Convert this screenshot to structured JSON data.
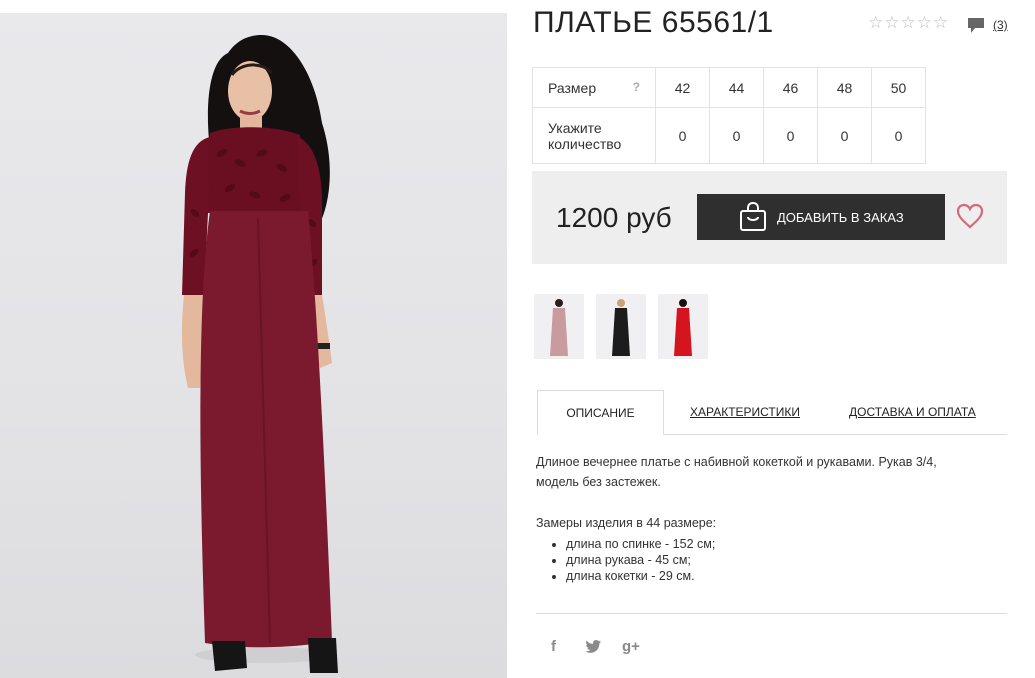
{
  "product": {
    "title": "ПЛАТЬЕ 65561/1",
    "review_count": "(3)",
    "rating_stars": 0
  },
  "sizes": {
    "size_label": "Размер",
    "help_label": "?",
    "qty_label_line1": "Укажите",
    "qty_label_line2": "количество",
    "list": [
      {
        "size": "42",
        "qty": "0"
      },
      {
        "size": "44",
        "qty": "0"
      },
      {
        "size": "46",
        "qty": "0"
      },
      {
        "size": "48",
        "qty": "0"
      },
      {
        "size": "50",
        "qty": "0"
      }
    ]
  },
  "purchase": {
    "price": "1200 руб",
    "add_button": "ДОБАВИТЬ В ЗАКАЗ"
  },
  "thumbnails": [
    {
      "color_name": "rose",
      "dress_color": "#c99a9e"
    },
    {
      "color_name": "black",
      "dress_color": "#1c1c1c"
    },
    {
      "color_name": "red",
      "dress_color": "#d4141e"
    }
  ],
  "tabs": [
    {
      "label": "ОПИСАНИЕ",
      "active": true
    },
    {
      "label": "ХАРАКТЕРИСТИКИ",
      "active": false
    },
    {
      "label": "ДОСТАВКА И ОПЛАТА",
      "active": false
    }
  ],
  "description": {
    "text": "Длиное вечернее платье с набивной кокеткой и рукавами. Рукав 3/4, модель без застежек.",
    "measures_title": "Замеры изделия в 44 размере:",
    "measures": [
      "длина по спинке - 152 см;",
      "длина рукава - 45 см;",
      "длина кокетки - 29 см."
    ]
  },
  "social": {
    "facebook": "f",
    "twitter": "twitter-bird",
    "google_plus": "g+"
  },
  "colors": {
    "dress": "#7b1a2e",
    "button": "#2f2f2f",
    "heart": "#d36a7c",
    "price_box": "#eeeeee"
  }
}
